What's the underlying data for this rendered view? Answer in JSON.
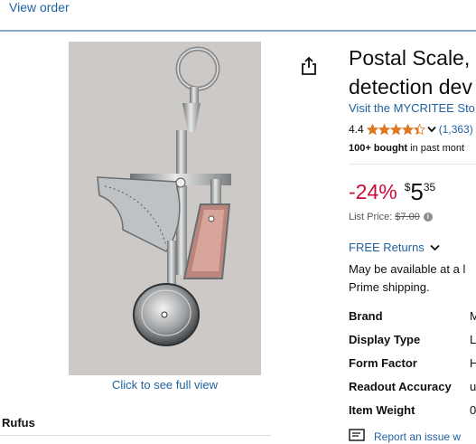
{
  "nav": {
    "view_order": "View order"
  },
  "product": {
    "title_line1": "Postal Scale,",
    "title_line2": "detection dev",
    "store_link": "Visit the MYCRITEE Sto",
    "rating_value": "4.4",
    "stars": 4.4,
    "review_count": "(1,363)",
    "bought_bold": "100+ bought",
    "bought_rest": " in past mont",
    "discount": "-24%",
    "currency": "$",
    "price_whole": "5",
    "price_fraction": "35",
    "list_price_label": "List Price:",
    "list_price_value": "$7.00",
    "returns": "FREE Returns",
    "availability_line1": "May be available at a l",
    "availability_line2": "Prime shipping.",
    "full_view": "Click to see full view"
  },
  "specs": [
    {
      "key": "Brand",
      "value": "M"
    },
    {
      "key": "Display Type",
      "value": "L"
    },
    {
      "key": "Form Factor",
      "value": "H"
    },
    {
      "key": "Readout Accuracy",
      "value": "u"
    },
    {
      "key": "Item Weight",
      "value": "0"
    }
  ],
  "report": "Report an issue w",
  "owner_name": "Rufus",
  "colors": {
    "link": "#2162a1",
    "discount": "#cc0c39",
    "star": "#de7921",
    "image_bg": "#ccc9c7"
  },
  "icons": [
    "share-icon",
    "star-icon",
    "chevron-down-icon",
    "info-icon",
    "report-icon"
  ]
}
